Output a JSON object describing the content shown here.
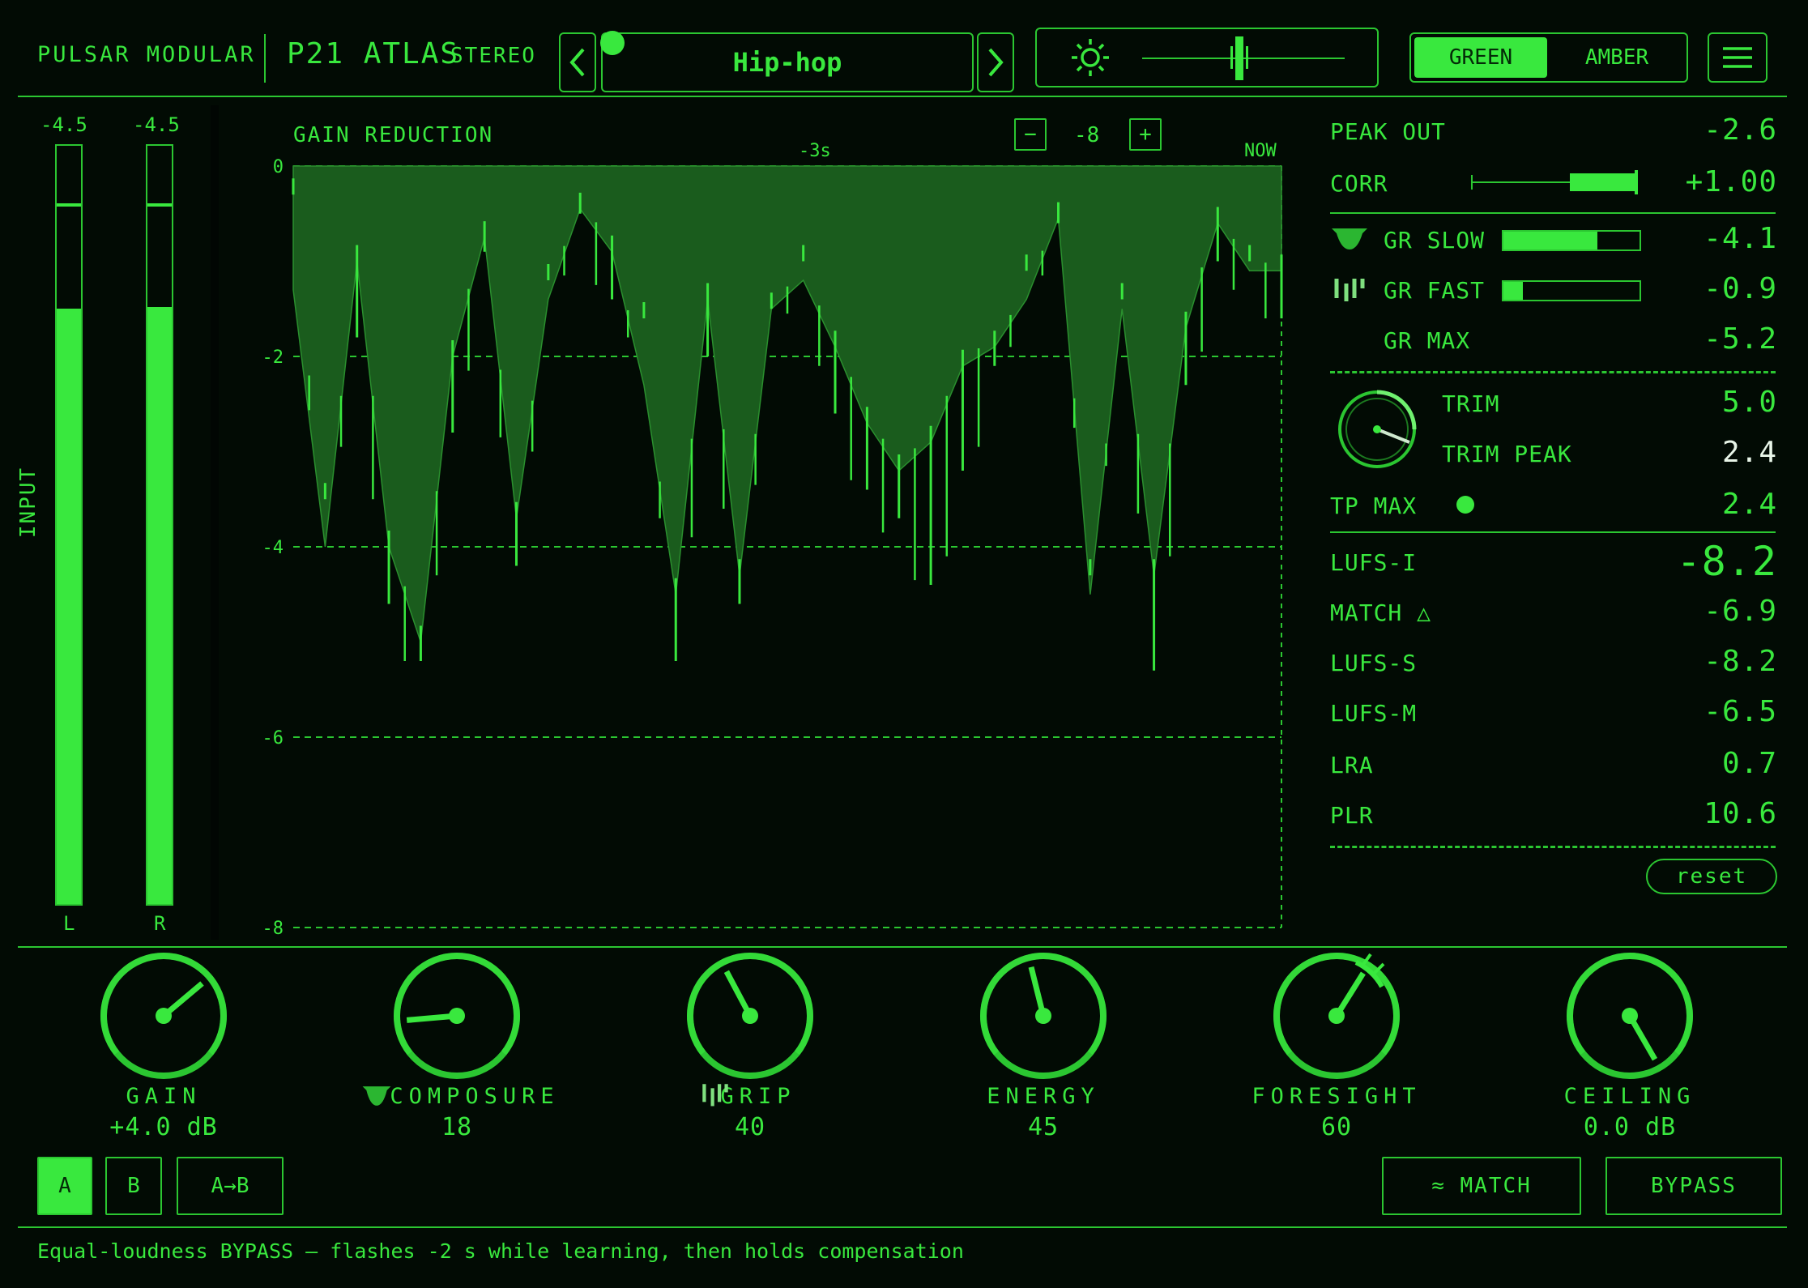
{
  "header": {
    "brand": "PULSAR MODULAR",
    "product": "P21 ATLAS",
    "mode": "STEREO",
    "preset": "Hip-hop",
    "prev_icon": "chevron-left-icon",
    "next_icon": "chevron-right-icon",
    "brightness_icon": "sun-icon",
    "brightness_level": 0.48,
    "theme_green": "GREEN",
    "theme_amber": "AMBER",
    "menu_icon": "hamburger-menu-icon"
  },
  "input_meters": {
    "title": "INPUT",
    "left": {
      "label": "L",
      "peak": "-4.5",
      "level": 0.785,
      "hold": 0.92
    },
    "right": {
      "label": "R",
      "peak": "-4.5",
      "level": 0.787,
      "hold": 0.92
    }
  },
  "graph": {
    "title": "GAIN REDUCTION",
    "zoom_minus": "−",
    "zoom_value": "-8",
    "zoom_plus": "+",
    "time_mid": "-3s",
    "time_now": "NOW",
    "y_ticks": [
      "0",
      "-2",
      "-4",
      "-6",
      "-8"
    ]
  },
  "chart_data": {
    "type": "area",
    "title": "GAIN REDUCTION",
    "ylim": [
      -8,
      0
    ],
    "x_ticks": [
      "-3s",
      "NOW"
    ],
    "series": [
      {
        "values": [
          -1.3,
          -4.0,
          -1.0,
          -4.0,
          -5.0,
          -2.0,
          -0.75,
          -3.7,
          -1.4,
          -0.45,
          -0.9,
          -2.3,
          -4.5,
          -1.4,
          -4.3,
          -1.5,
          -1.2,
          -1.9,
          -2.7,
          -3.2,
          -2.9,
          -2.1,
          -1.9,
          -1.4,
          -0.55,
          -4.5,
          -1.5,
          -4.3,
          -1.7,
          -0.6,
          -1.1,
          -1.1
        ]
      },
      {
        "values": [
          -0.3,
          -3.5,
          -1.8,
          -4.6,
          -5.2,
          -2.8,
          -0.9,
          -4.2,
          -1.2,
          -0.5,
          -1.4,
          -1.6,
          -5.2,
          -2.0,
          -4.6,
          -1.5,
          -1.0,
          -2.6,
          -3.4,
          -3.7,
          -4.4,
          -3.2,
          -2.1,
          -1.1,
          -0.6,
          -4.3,
          -1.4,
          -5.3,
          -2.3,
          -1.0,
          -1.0,
          -1.6
        ]
      }
    ]
  },
  "readouts": {
    "peak_out": {
      "label": "PEAK OUT",
      "value": "-2.6"
    },
    "corr": {
      "label": "CORR",
      "value": "+1.00",
      "level": 1.0
    },
    "gr_slow": {
      "label": "GR SLOW",
      "value": "-4.1",
      "level": 0.69
    },
    "gr_fast": {
      "label": "GR FAST",
      "value": "-0.9",
      "level": 0.14
    },
    "gr_max": {
      "label": "GR MAX",
      "value": "-5.2"
    },
    "trim": {
      "label": "TRIM",
      "value": "5.0"
    },
    "trim_peak": {
      "label": "TRIM PEAK",
      "value": "2.4"
    },
    "tp_max": {
      "label": "TP MAX",
      "value": "2.4"
    },
    "lufs_i": {
      "label": "LUFS-I",
      "value": "-8.2"
    },
    "match": {
      "label": "MATCH △",
      "value": "-6.9"
    },
    "lufs_s": {
      "label": "LUFS-S",
      "value": "-8.2"
    },
    "lufs_m": {
      "label": "LUFS-M",
      "value": "-6.5"
    },
    "lra": {
      "label": "LRA",
      "value": "0.7"
    },
    "plr": {
      "label": "PLR",
      "value": "10.6"
    },
    "reset": "reset"
  },
  "knobs": [
    {
      "label": "GAIN",
      "value": "+4.0 dB",
      "angle": 50
    },
    {
      "label": "COMPOSURE",
      "value": "18",
      "angle": -95
    },
    {
      "label": "GRIP",
      "value": "40",
      "angle": -28
    },
    {
      "label": "ENERGY",
      "value": "45",
      "angle": -14
    },
    {
      "label": "FORESIGHT",
      "value": "60",
      "angle": 32
    },
    {
      "label": "CEILING",
      "value": "0.0 dB",
      "angle": 150
    }
  ],
  "footer": {
    "slot_a": "A",
    "slot_b": "B",
    "copy_ab": "A→B",
    "match_btn": "≈ MATCH",
    "bypass_btn": "BYPASS",
    "status": "Equal-loudness BYPASS — flashes -2 s while learning, then holds compensation"
  },
  "colors": {
    "accent": "#39e83e",
    "fill": "#1a5c1d",
    "bg": "#020b04"
  }
}
